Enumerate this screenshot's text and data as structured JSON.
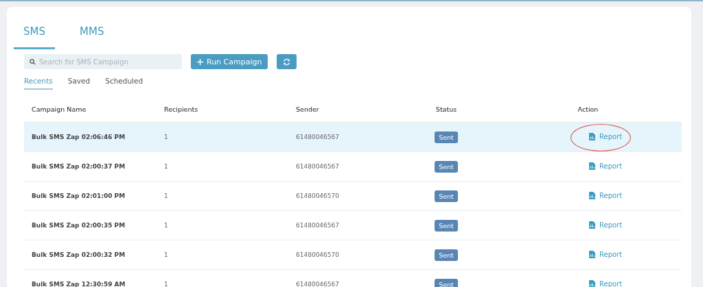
{
  "tabs": [
    {
      "label": "SMS",
      "selected": true
    },
    {
      "label": "MMS",
      "selected": false
    }
  ],
  "search": {
    "placeholder": "Search for SMS Campaign"
  },
  "buttons": [
    {
      "kind": "text",
      "label": "Run Campaign"
    },
    {
      "kind": "refresh"
    }
  ],
  "subtabs": [
    {
      "label": "Recents",
      "selected": true
    },
    {
      "label": "Saved",
      "selected": false
    },
    {
      "label": "Scheduled",
      "selected": false
    }
  ],
  "table": {
    "columns": [
      "Campaign Name",
      "Recipients",
      "Sender",
      "Status",
      "Action"
    ],
    "rows": [
      {
        "name": "Bulk SMS Zap 02:06:46 PM",
        "recipients": "1",
        "sender": "61480046567",
        "status": "Sent",
        "action": "Report",
        "selected": true,
        "circled": true
      },
      {
        "name": "Bulk SMS Zap 02:00:37 PM",
        "recipients": "1",
        "sender": "61480046567",
        "status": "Sent",
        "action": "Report",
        "selected": false,
        "circled": false
      },
      {
        "name": "Bulk SMS Zap 02:01:00 PM",
        "recipients": "1",
        "sender": "61480046570",
        "status": "Sent",
        "action": "Report",
        "selected": false,
        "circled": false
      },
      {
        "name": "Bulk SMS Zap 02:00:35 PM",
        "recipients": "1",
        "sender": "61480046567",
        "status": "Sent",
        "action": "Report",
        "selected": false,
        "circled": false
      },
      {
        "name": "Bulk SMS Zap 02:00:32 PM",
        "recipients": "1",
        "sender": "61480046570",
        "status": "Sent",
        "action": "Report",
        "selected": false,
        "circled": false
      },
      {
        "name": "Bulk SMS Zap 12:30:59 AM",
        "recipients": "1",
        "sender": "61480046567",
        "status": "Sent",
        "action": "Report",
        "selected": false,
        "circled": false
      }
    ]
  }
}
